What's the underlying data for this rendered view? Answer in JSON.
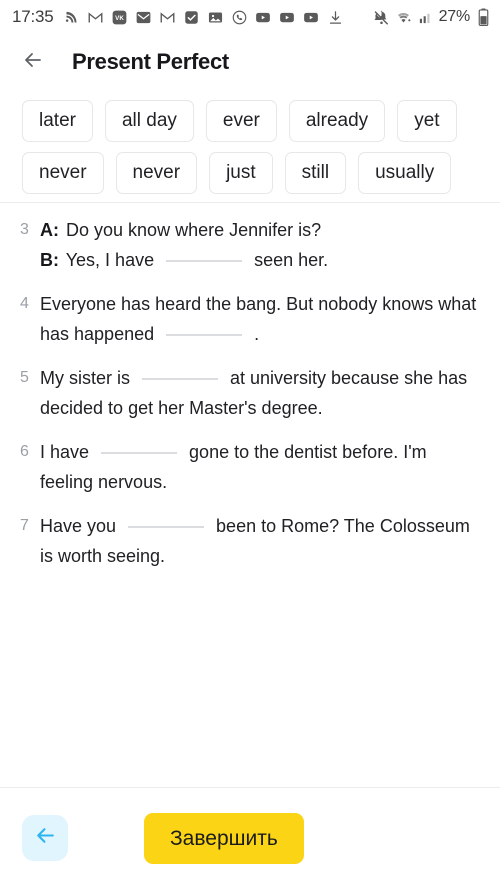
{
  "status_bar": {
    "time": "17:35",
    "battery_text": "27%",
    "left_icons": [
      "rss-feed-icon",
      "gmail-outline-icon",
      "vk-icon",
      "mail-envelope-icon",
      "gmail-outline-icon-2",
      "checkbox-checked-icon",
      "photo-image-icon",
      "viber-call-icon",
      "youtube-icon",
      "youtube-icon-2",
      "youtube-icon-3",
      "download-icon"
    ],
    "right_icons": [
      "mute-bell-off-icon",
      "wifi-icon",
      "cellular-signal-icon",
      "battery-icon"
    ]
  },
  "header": {
    "back_icon": "arrow-left-icon",
    "title": "Present Perfect"
  },
  "word_bank": {
    "chips": [
      {
        "label": "later"
      },
      {
        "label": "all day"
      },
      {
        "label": "ever"
      },
      {
        "label": "already"
      },
      {
        "label": "yet"
      },
      {
        "label": "never"
      },
      {
        "label": "never"
      },
      {
        "label": "just"
      },
      {
        "label": "still"
      },
      {
        "label": "usually"
      }
    ]
  },
  "exercises": [
    {
      "number": "3",
      "lines": [
        {
          "speaker": "A:",
          "before": "Do you know where Jennifer is?",
          "blank": false,
          "after": ""
        },
        {
          "speaker": "B:",
          "before": "Yes, I have",
          "blank": true,
          "after": "seen her."
        }
      ]
    },
    {
      "number": "4",
      "lines": [
        {
          "speaker": "",
          "before": "Everyone has heard the bang. But nobody knows what has happened",
          "blank": true,
          "after": "."
        }
      ]
    },
    {
      "number": "5",
      "lines": [
        {
          "speaker": "",
          "before": "My sister is",
          "blank": true,
          "after": "at university because she has decided to get her Master's degree."
        }
      ]
    },
    {
      "number": "6",
      "lines": [
        {
          "speaker": "",
          "before": "I have",
          "blank": true,
          "after": "gone to the dentist before. I'm feeling nervous."
        }
      ]
    },
    {
      "number": "7",
      "lines": [
        {
          "speaker": "",
          "before": "Have you",
          "blank": true,
          "after": "been to Rome? The Colosseum is worth seeing."
        }
      ]
    }
  ],
  "footer": {
    "back_icon": "arrow-left-icon",
    "finish_label": "Завершить"
  },
  "colors": {
    "accent_yellow": "#FAD415",
    "back_button_bg": "#E1F5FE",
    "back_button_fg": "#2CB5F0",
    "text_primary": "#202124",
    "text_muted": "#9AA0A6",
    "chip_border": "#E6E7E9",
    "divider": "#ECECEC"
  }
}
